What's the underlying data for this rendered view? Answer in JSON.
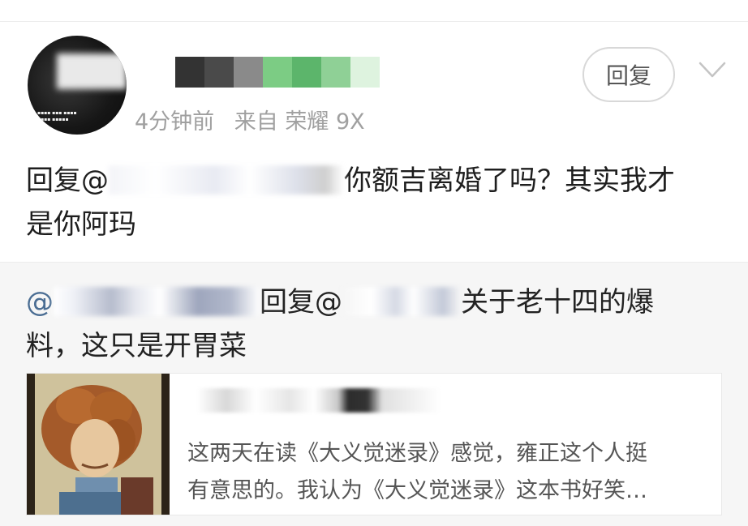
{
  "comment": {
    "meta": {
      "time": "4分钟前",
      "source": "来自 荣耀 9X"
    },
    "reply_button": "回复",
    "text": {
      "prefix": "回复@",
      "body_line1": "你额吉离婚了吗？其实我才",
      "body_line2": "是你阿玛"
    },
    "name_colors": [
      "#333333",
      "#4a4a4a",
      "#8a8a8a",
      "#7ccc84",
      "#5cb56b",
      "#8fd096",
      "#def3df"
    ]
  },
  "quote": {
    "prefix": "@",
    "mid": "回复@",
    "body_line1": "关于老十四的爆",
    "body_line2": "料，这只是开胃菜",
    "card": {
      "desc_line1": "这两天在读《大义觉迷录》感觉，雍正这个人挺",
      "desc_line2": "有意思的。我认为《大义觉迷录》这本书好笑…"
    }
  }
}
